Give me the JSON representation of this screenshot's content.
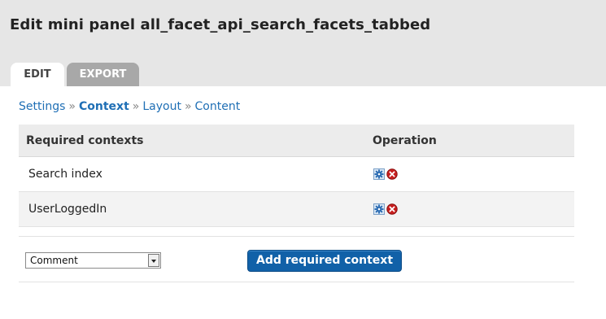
{
  "page_title": "Edit mini panel all_facet_api_search_facets_tabbed",
  "tabs": [
    {
      "label": "EDIT",
      "active": true
    },
    {
      "label": "EXPORT",
      "active": false
    }
  ],
  "breadcrumb": {
    "items": [
      {
        "label": "Settings",
        "active": false
      },
      {
        "label": "Context",
        "active": true
      },
      {
        "label": "Layout",
        "active": false
      },
      {
        "label": "Content",
        "active": false
      }
    ],
    "separator": "»"
  },
  "table": {
    "headers": [
      "Required contexts",
      "Operation"
    ],
    "rows": [
      {
        "name": "Search index",
        "operations": [
          "gear-icon",
          "delete-icon"
        ]
      },
      {
        "name": "UserLoggedIn",
        "operations": [
          "gear-icon",
          "delete-icon"
        ]
      }
    ]
  },
  "add_context": {
    "selected_option": "Comment",
    "button_label": "Add required context"
  },
  "colors": {
    "link": "#1f6fb5",
    "button": "#1161a8",
    "header_bg": "#e6e6e6",
    "delete": "#c81e1e"
  }
}
